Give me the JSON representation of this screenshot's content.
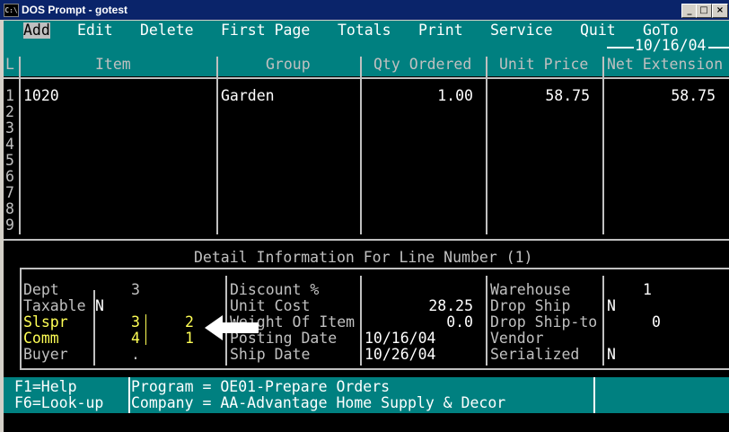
{
  "window": {
    "title": "DOS Prompt - gotest",
    "icon_label": "C:\\",
    "minimize": "_",
    "maximize": "□",
    "close": "×"
  },
  "menu": {
    "items": [
      "Add",
      "Edit",
      "Delete",
      "First Page",
      "Totals",
      "Print",
      "Service",
      "Quit",
      "GoTo"
    ],
    "date": "10/16/04"
  },
  "table": {
    "headers": {
      "line": "L",
      "item": "Item",
      "group": "Group",
      "qty": "Qty Ordered",
      "price": "Unit Price",
      "ext": "Net Extension"
    },
    "line_numbers": [
      "1",
      "2",
      "3",
      "4",
      "5",
      "6",
      "7",
      "8",
      "9"
    ],
    "rows": [
      {
        "item": "1020",
        "group": "Garden",
        "qty": "1.00",
        "price": "58.75",
        "ext": "58.75"
      }
    ]
  },
  "detail": {
    "title": "Detail Information For Line Number (1)",
    "dept_label": "Dept",
    "dept_value": "3",
    "taxable_label": "Taxable",
    "taxable_value": "N",
    "slspr_label": "Slspr",
    "slspr_value1": "3",
    "slspr_value2": "2",
    "comm_label": "Comm",
    "comm_value1": "4",
    "comm_value2": "1",
    "buyer_label": "Buyer",
    "buyer_value": ".",
    "discount_label": "Discount %",
    "discount_value": "",
    "unit_cost_label": "Unit Cost",
    "unit_cost_value": "28.25",
    "weight_label": "Weight Of Item",
    "weight_value": "0.0",
    "posting_label": "Posting Date",
    "posting_value": "10/16/04",
    "ship_label": "Ship Date",
    "ship_value": "10/26/04",
    "warehouse_label": "Warehouse",
    "warehouse_value": "1",
    "dropship_label": "Drop Ship",
    "dropship_value": "N",
    "dropship_to_label": "Drop Ship-to",
    "dropship_to_value": "0",
    "vendor_label": "Vendor",
    "vendor_value": "",
    "serialized_label": "Serialized",
    "serialized_value": "N"
  },
  "status": {
    "f1": "F1=Help",
    "f6": "F6=Look-up",
    "program": "Program = OE01-Prepare Orders",
    "company": "Company = AA-Advantage Home Supply & Decor"
  },
  "colors": {
    "teal": "#008080",
    "yellow": "#ffff55",
    "titlebar": "#0a246a"
  }
}
